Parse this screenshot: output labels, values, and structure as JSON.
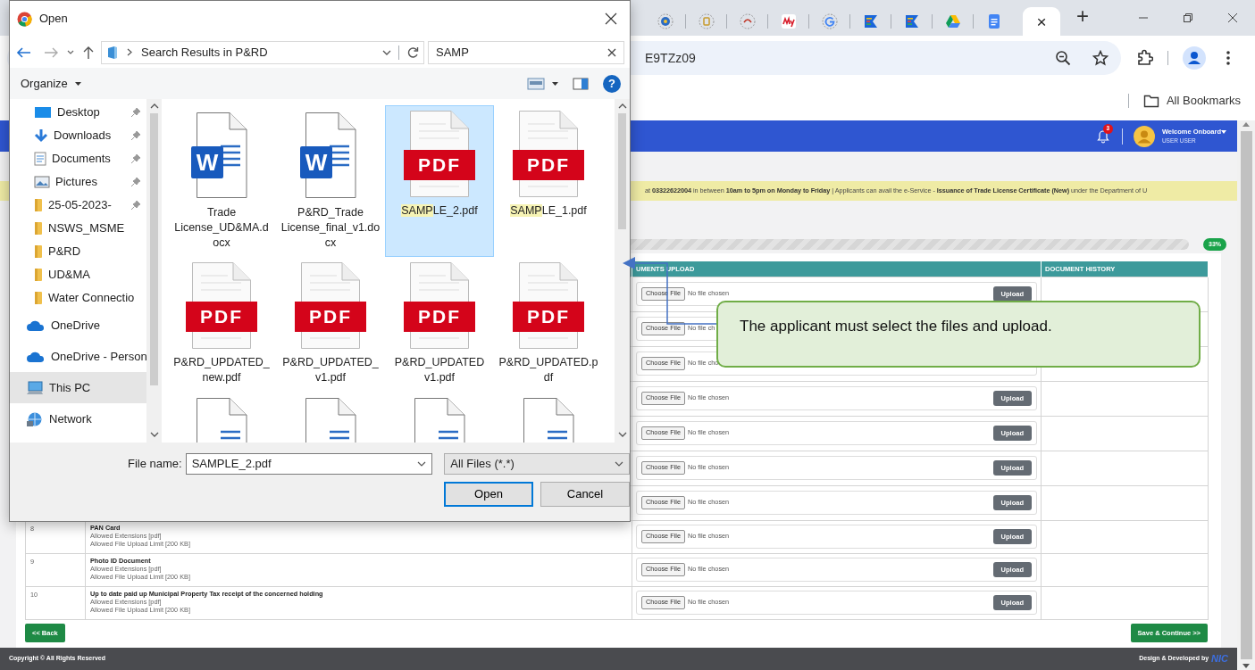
{
  "browser": {
    "tabs": [
      {
        "kind": "globe",
        "selected": false
      },
      {
        "kind": "bag",
        "selected": false
      },
      {
        "kind": "ring",
        "selected": false
      },
      {
        "kind": "my",
        "selected": false
      },
      {
        "kind": "google",
        "selected": false
      },
      {
        "kind": "flag",
        "selected": false
      },
      {
        "kind": "flag",
        "selected": false
      },
      {
        "kind": "drive",
        "selected": false
      },
      {
        "kind": "docs",
        "selected": false
      },
      {
        "kind": "blank",
        "selected": true,
        "close": "×"
      }
    ],
    "new_tab": "+",
    "address": "E9TZz09",
    "bookmarks": [
      "All Bookmarks"
    ]
  },
  "page": {
    "header": {
      "notifications": "3",
      "greeting": "Welcome Onboard",
      "user_name": "USER USER"
    },
    "announcement": "at **03322622004** in between **10am to 5pm on Monday to Friday** | Applicants can avail the e-Service - **Issuance of Trade License Certificate (New)** under the Department of U",
    "progress_label": "33%",
    "table": {
      "columns": [
        "UMENTS UPLOAD",
        "DOCUMENT HISTORY"
      ],
      "rows": [
        {
          "choose": "Choose File",
          "status": "No file chosen",
          "upload": "Upload"
        },
        {
          "choose": "Choose File",
          "status": "No file ch"
        },
        {
          "choose": "Choose File",
          "status": "No file cho"
        },
        {
          "choose": "Choose File",
          "status": "No file chosen",
          "upload": "Upload"
        },
        {
          "choose": "Choose File",
          "status": "No file chosen",
          "upload": "Upload"
        },
        {
          "choose": "Choose File",
          "status": "No file chosen",
          "upload": "Upload"
        },
        {
          "choose": "Choose File",
          "status": "No file chosen",
          "upload": "Upload"
        },
        {
          "number": "8",
          "title": "PAN Card",
          "extensions": "Allowed Extensions [pdf]",
          "limit": "Allowed File Upload Limit [200 KB]",
          "choose": "Choose File",
          "status": "No file chosen",
          "upload": "Upload"
        },
        {
          "number": "9",
          "title": "Photo ID Document",
          "extensions": "Allowed Extensions [pdf]",
          "limit": "Allowed File Upload Limit [200 KB]",
          "choose": "Choose File",
          "status": "No file chosen",
          "upload": "Upload"
        },
        {
          "number": "10",
          "title": "Up to date paid up Municipal Property Tax receipt of the concerned holding",
          "extensions": "Allowed Extensions [pdf]",
          "limit": "Allowed File Upload Limit [200 KB]",
          "choose": "Choose File",
          "status": "No file chosen",
          "upload": "Upload"
        }
      ]
    },
    "buttons": [
      "<< Back",
      "Save & Continue >>"
    ],
    "footer": {
      "copyright": "Copyright © All Rights Reserved",
      "credit": "Design & Developed by",
      "logo": "NIC"
    }
  },
  "dialog": {
    "title": "Open",
    "path": "Search Results in P&RD",
    "search": "SAMP",
    "organize": "Organize",
    "help": "?",
    "nav": [
      {
        "label": "Desktop",
        "kind": "desktop",
        "pinned": true,
        "selected": false
      },
      {
        "label": "Downloads",
        "kind": "downloads",
        "pinned": true,
        "selected": false
      },
      {
        "label": "Documents",
        "kind": "documents",
        "pinned": true,
        "selected": false
      },
      {
        "label": "Pictures",
        "kind": "pictures",
        "pinned": true,
        "selected": false
      },
      {
        "label": "25-05-2023-",
        "kind": "folder",
        "pinned": true,
        "selected": false
      },
      {
        "label": "NSWS_MSME",
        "kind": "folder",
        "pinned": false,
        "selected": false
      },
      {
        "label": "P&RD",
        "kind": "folder",
        "pinned": false,
        "selected": false
      },
      {
        "label": "UD&MA",
        "kind": "folder",
        "pinned": false,
        "selected": false
      },
      {
        "label": "Water Connectio",
        "kind": "folder",
        "pinned": false,
        "selected": false
      },
      {
        "label": "OneDrive",
        "kind": "cloud",
        "pinned": false,
        "selected": false
      },
      {
        "label": "OneDrive - Person",
        "kind": "cloud",
        "pinned": false,
        "selected": false
      },
      {
        "label": "This PC",
        "kind": "pc",
        "pinned": false,
        "selected": true
      },
      {
        "label": "Network",
        "kind": "network",
        "pinned": false,
        "selected": false
      }
    ],
    "files": [
      {
        "kind": "word",
        "badge": "W",
        "name_parts": [
          {
            "text": "Trade License_UD&MA.docx",
            "highlighted": false
          }
        ],
        "selected": false
      },
      {
        "kind": "word",
        "badge": "W",
        "name_parts": [
          {
            "text": "P&RD_Trade License_final_v1.docx",
            "highlighted": false
          }
        ],
        "selected": false
      },
      {
        "kind": "pdf",
        "badge": "PDF",
        "name_parts": [
          {
            "text": "SAMP",
            "highlighted": true
          },
          {
            "text": "LE_2.pdf",
            "highlighted": false
          }
        ],
        "selected": true
      },
      {
        "kind": "pdf",
        "badge": "PDF",
        "name_parts": [
          {
            "text": "SAMP",
            "highlighted": true
          },
          {
            "text": "LE_1.pdf",
            "highlighted": false
          }
        ],
        "selected": false
      },
      {
        "kind": "pdf",
        "badge": "PDF",
        "name_parts": [
          {
            "text": "P&RD_UPDATED_new.pdf",
            "highlighted": false
          }
        ],
        "selected": false
      },
      {
        "kind": "pdf",
        "badge": "PDF",
        "name_parts": [
          {
            "text": "P&RD_UPDATED_v1.pdf",
            "highlighted": false
          }
        ],
        "selected": false
      },
      {
        "kind": "pdf",
        "badge": "PDF",
        "name_parts": [
          {
            "text": "P&RD_UPDATED v1.pdf",
            "highlighted": false
          }
        ],
        "selected": false
      },
      {
        "kind": "pdf",
        "badge": "PDF",
        "name_parts": [
          {
            "text": "P&RD_UPDATED.pdf",
            "highlighted": false
          }
        ],
        "selected": false
      },
      {
        "kind": "word",
        "selected": false
      },
      {
        "kind": "word",
        "selected": false
      },
      {
        "kind": "word",
        "selected": false
      },
      {
        "kind": "word",
        "selected": false
      }
    ],
    "file_name_label": "File name:",
    "file_name": "SAMPLE_2.pdf",
    "filter": "All Files (*.*)",
    "buttons": [
      {
        "label": "Open",
        "default": true
      },
      {
        "label": "Cancel",
        "default": false
      }
    ]
  },
  "callout": "The applicant must select the files and upload."
}
